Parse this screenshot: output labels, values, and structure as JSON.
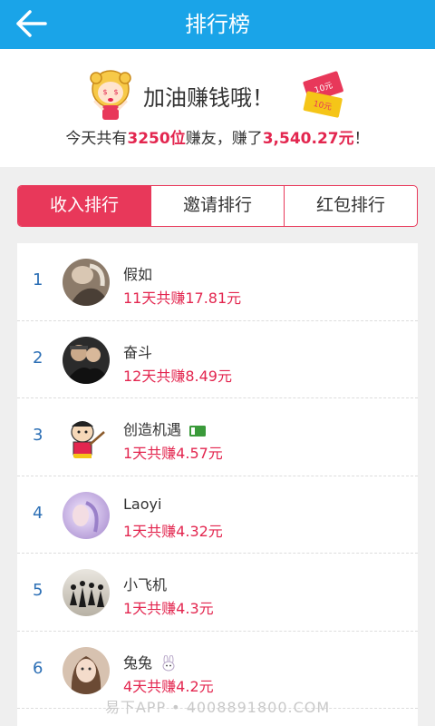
{
  "header": {
    "title": "排行榜"
  },
  "hero": {
    "slogan": "加油赚钱哦！",
    "summary_prefix": "今天共有",
    "user_count": "3250位",
    "summary_mid": "赚友，赚了",
    "total_amount": "3,540.27元",
    "summary_suffix": "！",
    "coin_label_1": "10元",
    "coin_label_2": "10元"
  },
  "tabs": [
    {
      "label": "收入排行",
      "active": true
    },
    {
      "label": "邀请排行",
      "active": false
    },
    {
      "label": "红包排行",
      "active": false
    }
  ],
  "ranking": [
    {
      "rank": "1",
      "name": "假如",
      "earnings": "11天共赚17.81元"
    },
    {
      "rank": "2",
      "name": "奋斗",
      "earnings": "12天共赚8.49元"
    },
    {
      "rank": "3",
      "name": "创造机遇",
      "earnings": "1天共赚4.57元"
    },
    {
      "rank": "4",
      "name": "Laoyi",
      "earnings": "1天共赚4.32元"
    },
    {
      "rank": "5",
      "name": "小飞机",
      "earnings": "1天共赚4.3元"
    },
    {
      "rank": "6",
      "name": "兔兔",
      "earnings": "4天共赚4.2元"
    }
  ],
  "watermark": "易下APP • 4008891800.COM",
  "colors": {
    "primary": "#1aa4e8",
    "accent": "#e8385a",
    "rank_blue": "#2c6fb5",
    "money_red": "#e3264f"
  }
}
